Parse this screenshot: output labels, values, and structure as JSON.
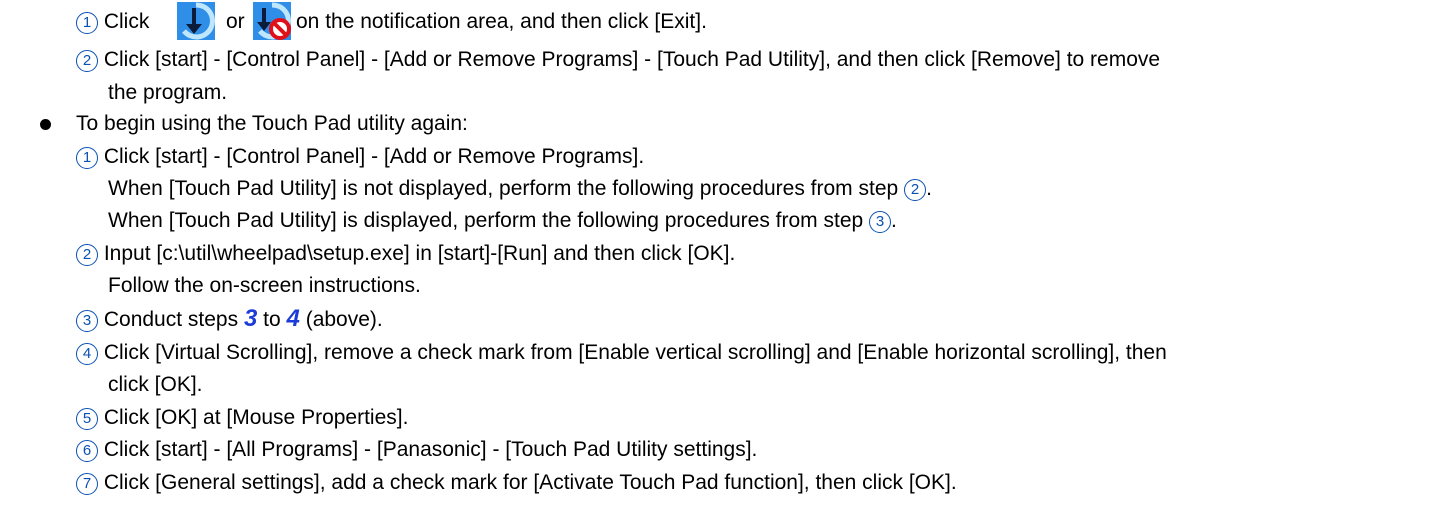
{
  "exit": {
    "step1_n": "1",
    "step1_a": "Click",
    "step1_or": "or",
    "step1_b": "on the notification area, and then click [Exit].",
    "step2_n": "2",
    "step2_a": "Click [start] - [Control Panel] - [Add or Remove Programs] - [Touch Pad Utility], and then click [Remove] to remove",
    "step2_b": "the program.",
    "icon_a": "touchpad-utility-icon",
    "icon_b": "touchpad-utility-disabled-icon",
    "colors": {
      "number": "#0a50b4",
      "step_ref": "#1c3cd8"
    }
  },
  "begin": {
    "heading": "To begin using the Touch Pad utility again:",
    "s1_n": "1",
    "s1_l1": "Click [start] - [Control Panel] - [Add or Remove Programs].",
    "s1_l2": "When [Touch Pad Utility] is not displayed, perform the following procedures from step",
    "s1_l2_ref": "2",
    "s1_l2_end": ".",
    "s1_l3": "When [Touch Pad Utility] is displayed, perform the following procedures from step",
    "s1_l3_ref": "3",
    "s1_l3_end": ".",
    "s2_n": "2",
    "s2_l1": "Input [c:\\util\\wheelpad\\setup.exe] in [start]-[Run] and then click [OK].",
    "s2_l2": "Follow the on-screen instructions.",
    "s3_n": "3",
    "s3_a": "Conduct steps",
    "s3_ref1": "3",
    "s3_to": "to",
    "s3_ref2": "4",
    "s3_b": "(above).",
    "s4_n": "4",
    "s4_l1": "Click [Virtual Scrolling], remove a check mark from [Enable vertical scrolling] and [Enable horizontal scrolling], then",
    "s4_l2": "click [OK].",
    "s5_n": "5",
    "s5": "Click [OK] at [Mouse Properties].",
    "s6_n": "6",
    "s6": "Click [start] - [All Programs] - [Panasonic] - [Touch Pad Utility settings].",
    "s7_n": "7",
    "s7": "Click [General settings], add a check mark for [Activate Touch Pad function], then click [OK]."
  }
}
